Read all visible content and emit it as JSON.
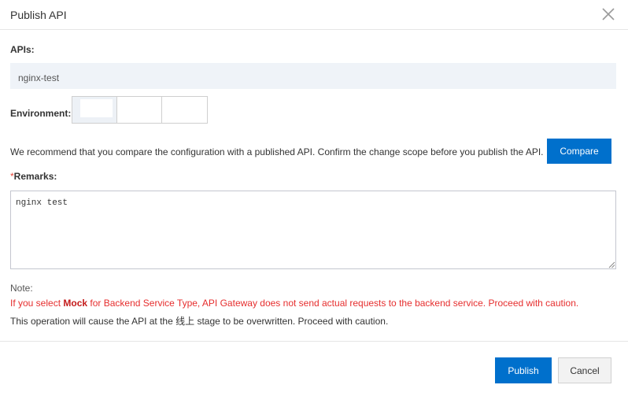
{
  "dialog": {
    "title": "Publish API",
    "close_icon": "close-icon"
  },
  "apis": {
    "label": "APIs:",
    "value": "nginx-test"
  },
  "environment": {
    "label": "Environment:",
    "options": [
      "",
      "",
      ""
    ],
    "selected_index": 0
  },
  "recommend": {
    "text": "We recommend that you compare the configuration with a published API. Confirm the change scope before you publish the API.",
    "compare_label": "Compare"
  },
  "remarks": {
    "required_mark": "*",
    "label": "Remarks:",
    "value": "nginx test"
  },
  "note": {
    "title": "Note:",
    "warning_prefix": "If you select ",
    "warning_bold": "Mock",
    "warning_suffix": " for Backend Service Type, API Gateway does not send actual requests to the backend service. Proceed with caution.",
    "info_prefix": "This operation will cause the API at the ",
    "info_stage": "线上",
    "info_suffix": " stage to be overwritten. Proceed with caution."
  },
  "footer": {
    "publish_label": "Publish",
    "cancel_label": "Cancel"
  },
  "colors": {
    "primary": "#0070cc",
    "warning": "#e62e2e",
    "required": "#e84738"
  }
}
